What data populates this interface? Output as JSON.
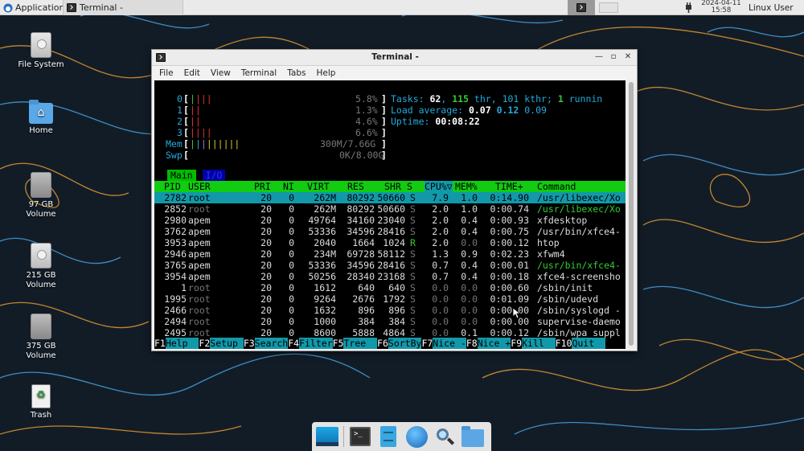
{
  "top_panel": {
    "applications_label": "Applications",
    "task_label": "Terminal -",
    "clock_date": "2024-04-11",
    "clock_time": "15:58",
    "user_label": "Linux User"
  },
  "desktop_icons": [
    {
      "label": "File System"
    },
    {
      "label": "Home"
    },
    {
      "label": "97 GB Volume"
    },
    {
      "label": "215 GB Volume"
    },
    {
      "label": "375 GB Volume"
    },
    {
      "label": "Trash"
    }
  ],
  "window": {
    "title": "Terminal -",
    "menu": [
      "File",
      "Edit",
      "View",
      "Terminal",
      "Tabs",
      "Help"
    ]
  },
  "htop": {
    "cpus": [
      {
        "id": "0",
        "bar": "|||",
        "pct": "5.8%"
      },
      {
        "id": "1",
        "bar": "||",
        "pct": "1.3%"
      },
      {
        "id": "2",
        "bar": "||",
        "pct": "4.6%"
      },
      {
        "id": "3",
        "bar": "||||",
        "pct": "6.6%"
      }
    ],
    "mem": {
      "label": "Mem",
      "bar": "||||||",
      "value": "300M/7.66G"
    },
    "swp": {
      "label": "Swp",
      "bar": "",
      "value": "0K/8.00G"
    },
    "tasks": {
      "label": "Tasks:",
      "tasks": "62",
      "thr": "115",
      "thr_label": "thr,",
      "kthr": "101 kthr;",
      "running": "1",
      "running_label": "runnin"
    },
    "load": {
      "label": "Load average:",
      "l1": "0.07",
      "l5": "0.12",
      "l15": "0.09"
    },
    "uptime": {
      "label": "Uptime:",
      "value": "00:08:22"
    },
    "tabs": {
      "main": "Main",
      "io": "I/O"
    },
    "columns": [
      "PID",
      "USER",
      "PRI",
      "NI",
      "VIRT",
      "RES",
      "SHR",
      "S",
      "CPU%▽",
      "MEM%",
      "TIME+",
      "Command"
    ],
    "processes": [
      {
        "pid": "2782",
        "user": "root",
        "pri": "20",
        "ni": "0",
        "virt": "262M",
        "res": "80292",
        "shr": "50660",
        "s": "S",
        "cpu": "7.9",
        "mem": "1.0",
        "time": "0:14.90",
        "cmd": "/usr/libexec/Xo"
      },
      {
        "pid": "2852",
        "user": "root",
        "pri": "20",
        "ni": "0",
        "virt": "262M",
        "res": "80292",
        "shr": "50660",
        "s": "S",
        "cpu": "2.0",
        "mem": "1.0",
        "time": "0:00.74",
        "cmd": "/usr/libexec/Xo"
      },
      {
        "pid": "2980",
        "user": "apem",
        "pri": "20",
        "ni": "0",
        "virt": "49764",
        "res": "34160",
        "shr": "23040",
        "s": "S",
        "cpu": "2.0",
        "mem": "0.4",
        "time": "0:00.93",
        "cmd": "xfdesktop"
      },
      {
        "pid": "3762",
        "user": "apem",
        "pri": "20",
        "ni": "0",
        "virt": "53336",
        "res": "34596",
        "shr": "28416",
        "s": "S",
        "cpu": "2.0",
        "mem": "0.4",
        "time": "0:00.75",
        "cmd": "/usr/bin/xfce4-"
      },
      {
        "pid": "3953",
        "user": "apem",
        "pri": "20",
        "ni": "0",
        "virt": "2040",
        "res": "1664",
        "shr": "1024",
        "s": "R",
        "cpu": "2.0",
        "mem": "0.0",
        "time": "0:00.12",
        "cmd": "htop"
      },
      {
        "pid": "2946",
        "user": "apem",
        "pri": "20",
        "ni": "0",
        "virt": "234M",
        "res": "69728",
        "shr": "58112",
        "s": "S",
        "cpu": "1.3",
        "mem": "0.9",
        "time": "0:02.23",
        "cmd": "xfwm4"
      },
      {
        "pid": "3765",
        "user": "apem",
        "pri": "20",
        "ni": "0",
        "virt": "53336",
        "res": "34596",
        "shr": "28416",
        "s": "S",
        "cpu": "0.7",
        "mem": "0.4",
        "time": "0:00.01",
        "cmd": "/usr/bin/xfce4-"
      },
      {
        "pid": "3954",
        "user": "apem",
        "pri": "20",
        "ni": "0",
        "virt": "50256",
        "res": "28340",
        "shr": "23168",
        "s": "S",
        "cpu": "0.7",
        "mem": "0.4",
        "time": "0:00.18",
        "cmd": "xfce4-screensho"
      },
      {
        "pid": "1",
        "user": "root",
        "pri": "20",
        "ni": "0",
        "virt": "1612",
        "res": "640",
        "shr": "640",
        "s": "S",
        "cpu": "0.0",
        "mem": "0.0",
        "time": "0:00.60",
        "cmd": "/sbin/init"
      },
      {
        "pid": "1995",
        "user": "root",
        "pri": "20",
        "ni": "0",
        "virt": "9264",
        "res": "2676",
        "shr": "1792",
        "s": "S",
        "cpu": "0.0",
        "mem": "0.0",
        "time": "0:01.09",
        "cmd": "/sbin/udevd"
      },
      {
        "pid": "2466",
        "user": "root",
        "pri": "20",
        "ni": "0",
        "virt": "1632",
        "res": "896",
        "shr": "896",
        "s": "S",
        "cpu": "0.0",
        "mem": "0.0",
        "time": "0:00.00",
        "cmd": "/sbin/syslogd -"
      },
      {
        "pid": "2494",
        "user": "root",
        "pri": "20",
        "ni": "0",
        "virt": "1000",
        "res": "384",
        "shr": "384",
        "s": "S",
        "cpu": "0.0",
        "mem": "0.0",
        "time": "0:00.00",
        "cmd": "supervise-daemo"
      },
      {
        "pid": "2495",
        "user": "root",
        "pri": "20",
        "ni": "0",
        "virt": "8600",
        "res": "5888",
        "shr": "4864",
        "s": "S",
        "cpu": "0.0",
        "mem": "0.1",
        "time": "0:00.12",
        "cmd": "/sbin/wpa_suppl"
      }
    ],
    "fkeys": [
      {
        "k": "F1",
        "v": "Help  "
      },
      {
        "k": "F2",
        "v": "Setup "
      },
      {
        "k": "F3",
        "v": "Search"
      },
      {
        "k": "F4",
        "v": "Filter"
      },
      {
        "k": "F5",
        "v": "Tree  "
      },
      {
        "k": "F6",
        "v": "SortBy"
      },
      {
        "k": "F7",
        "v": "Nice -"
      },
      {
        "k": "F8",
        "v": "Nice +"
      },
      {
        "k": "F9",
        "v": "Kill  "
      },
      {
        "k": "F10",
        "v": "Quit  "
      }
    ]
  },
  "dock": [
    "desktop-icon",
    "terminal-icon",
    "file-cabinet-icon",
    "web-browser-icon",
    "search-icon",
    "folder-icon"
  ],
  "colors": {
    "htop_green": "#11cc11",
    "htop_cyan": "#1199aa",
    "panel_bg": "#eaeaea"
  }
}
